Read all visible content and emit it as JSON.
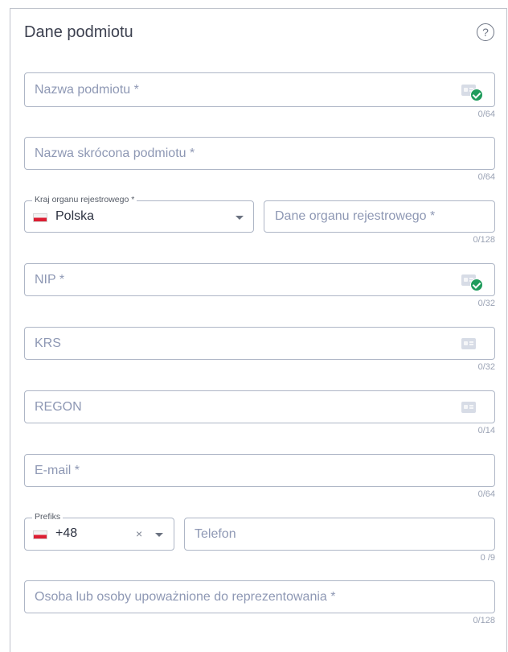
{
  "section": {
    "title": "Dane podmiotu",
    "help_icon": "?"
  },
  "fields": {
    "entity_name": {
      "placeholder": "Nazwa podmiotu *",
      "counter": "0/64",
      "value": ""
    },
    "short_name": {
      "placeholder": "Nazwa skrócona podmiotu *",
      "counter": "0/64",
      "value": ""
    },
    "registry_country": {
      "legend": "Kraj organu rejestrowego *",
      "value": "Polska"
    },
    "registry_data": {
      "placeholder": "Dane organu rejestrowego *",
      "counter": "0/128",
      "value": ""
    },
    "nip": {
      "placeholder": "NIP *",
      "counter": "0/32",
      "value": ""
    },
    "krs": {
      "placeholder": "KRS",
      "counter": "0/32",
      "value": ""
    },
    "regon": {
      "placeholder": "REGON",
      "counter": "0/14",
      "value": ""
    },
    "email": {
      "placeholder": "E-mail *",
      "counter": "0/64",
      "value": ""
    },
    "prefix": {
      "legend": "Prefiks",
      "value": "+48",
      "clear": "×"
    },
    "phone": {
      "placeholder": "Telefon",
      "counter": "0 /9",
      "value": ""
    },
    "representatives": {
      "placeholder": "Osoba lub osoby upoważnione do reprezentowania *",
      "counter": "0/128",
      "value": ""
    }
  },
  "colors": {
    "border": "#aeb6c6",
    "placeholder": "#8e98b4",
    "check": "#1f9c5c",
    "flag_red": "#dc1e32"
  },
  "icons": [
    "help-icon",
    "id-card-icon",
    "check-icon",
    "chevron-down-icon",
    "clear-icon",
    "poland-flag-icon"
  ]
}
